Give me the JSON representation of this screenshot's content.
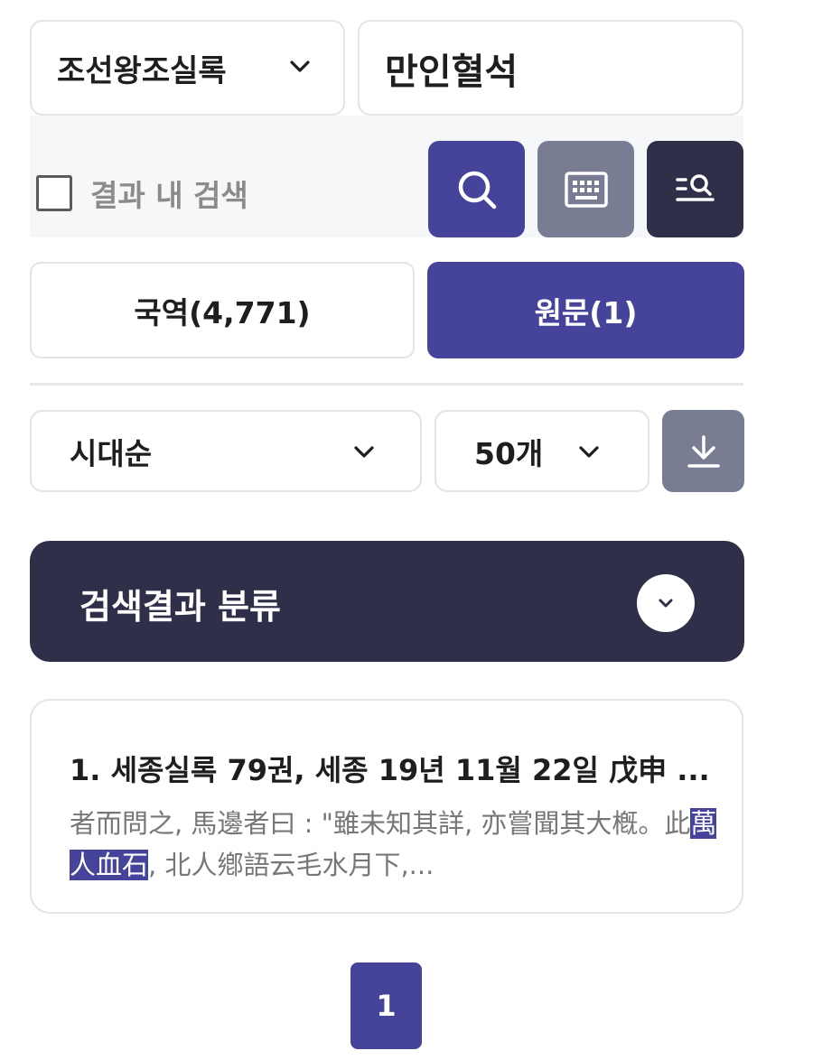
{
  "search": {
    "collection": "조선왕조실록",
    "query": "만인혈석",
    "search_within_label": "결과 내 검색",
    "search_within_checked": false
  },
  "tabs": [
    {
      "label": "국역(4,771)",
      "active": false
    },
    {
      "label": "원문(1)",
      "active": true
    }
  ],
  "sort": {
    "selected": "시대순"
  },
  "page_size": {
    "selected": "50개"
  },
  "category_bar": {
    "title": "검색결과 분류"
  },
  "results": [
    {
      "title": "1. 세종실록 79권, 세종 19년 11월 22일 戊申 ...",
      "snippet_before": "者而問之, 馬邊者曰 : \"雖未知其詳, 亦嘗聞其大槪。此",
      "snippet_highlight": "萬人血石",
      "snippet_after": ", 北人鄕語云毛水月下,..."
    }
  ],
  "pagination": {
    "current": "1"
  },
  "icons": {
    "collection_chevron": "chevron-down-icon",
    "search": "search-icon",
    "keyboard": "keyboard-icon",
    "detail_search": "detail-search-icon",
    "download": "download-icon",
    "category_toggle": "chevron-down-icon"
  },
  "colors": {
    "primary": "#46449a",
    "dark": "#2f2f49",
    "gray_button": "#787d94",
    "border": "#e3e4e8",
    "band": "#f6f7f9"
  }
}
